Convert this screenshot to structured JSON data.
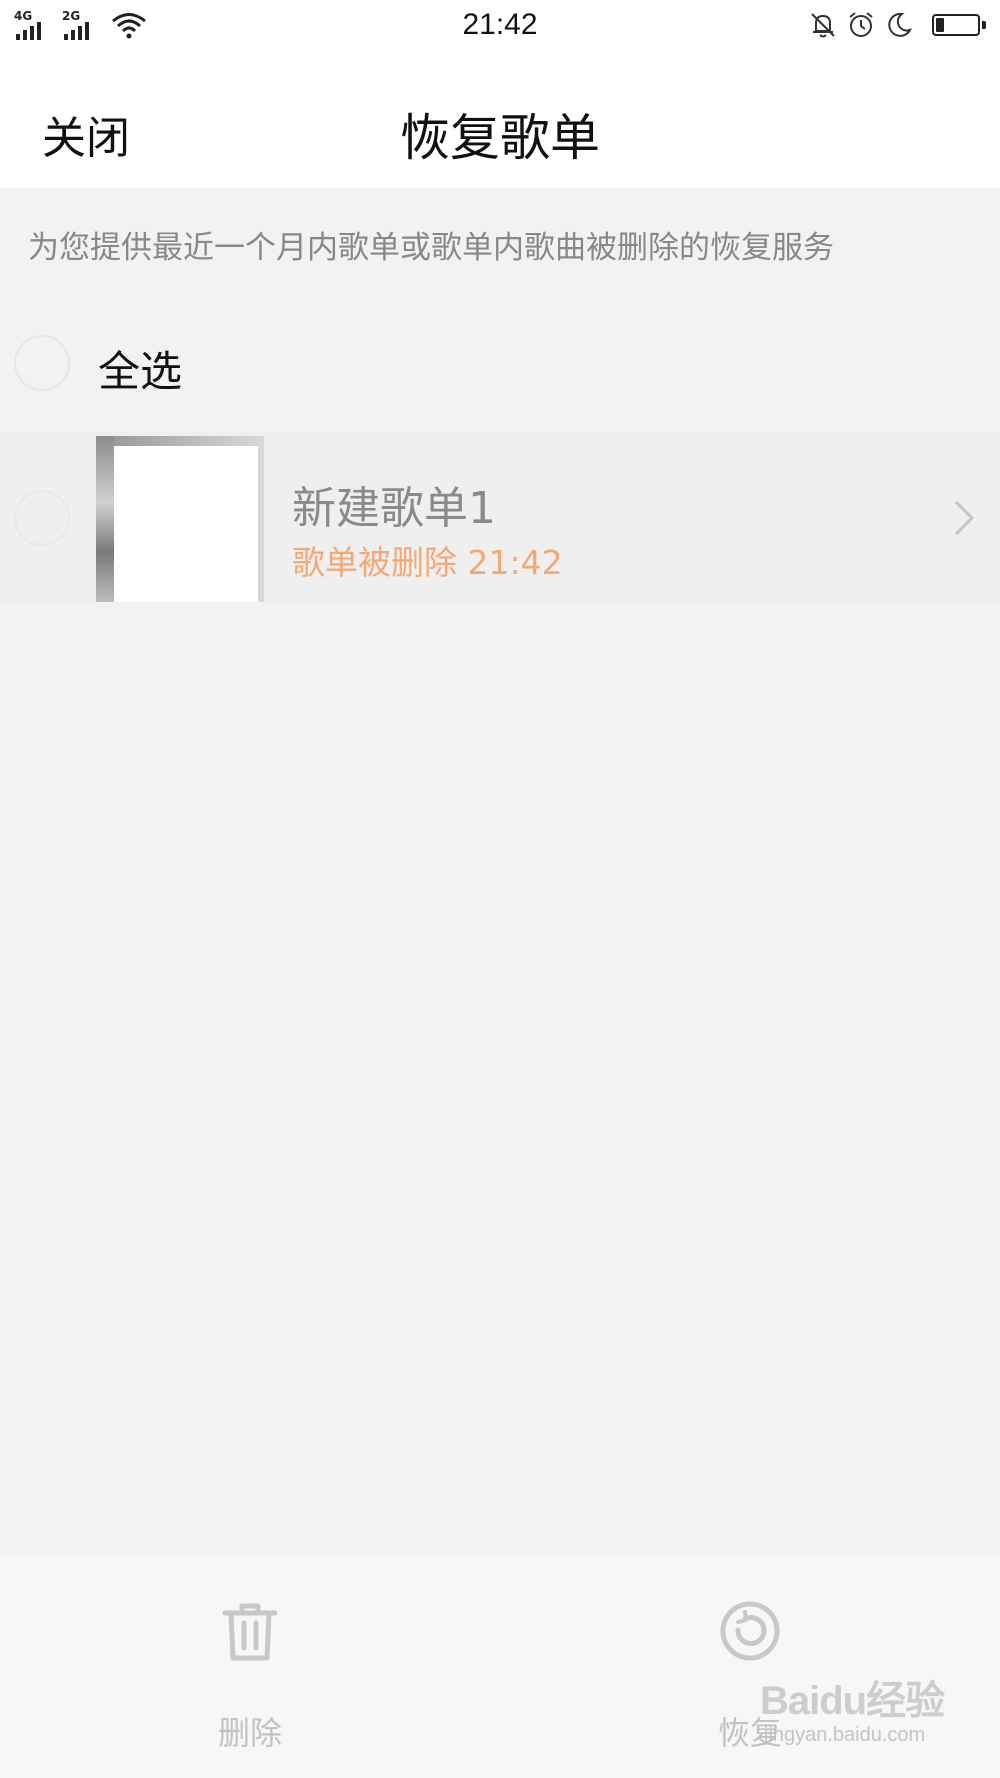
{
  "status_bar": {
    "time": "21:42",
    "signal1_label": "4G",
    "signal2_label": "2G",
    "icons": [
      "signal-icon",
      "signal-icon",
      "wifi-icon",
      "bell-muted-icon",
      "alarm-icon",
      "moon-icon",
      "battery-icon"
    ],
    "battery_level": 0.2
  },
  "header": {
    "close_label": "关闭",
    "title": "恢复歌单"
  },
  "info": {
    "text": "为您提供最近一个月内歌单或歌单内歌曲被删除的恢复服务"
  },
  "select_all": {
    "label": "全选",
    "checked": false
  },
  "playlists": [
    {
      "name": "新建歌单1",
      "status": "歌单被删除 21:42",
      "checked": false
    }
  ],
  "actions": {
    "delete_label": "删除",
    "restore_label": "恢复"
  },
  "watermark": {
    "main": "Baidu经验",
    "sub": "jingyan.baidu.com"
  },
  "colors": {
    "background": "#f2f2f2",
    "status_accent": "#f5a774",
    "muted_text": "#888888",
    "disabled_action": "#c2c2c2"
  }
}
